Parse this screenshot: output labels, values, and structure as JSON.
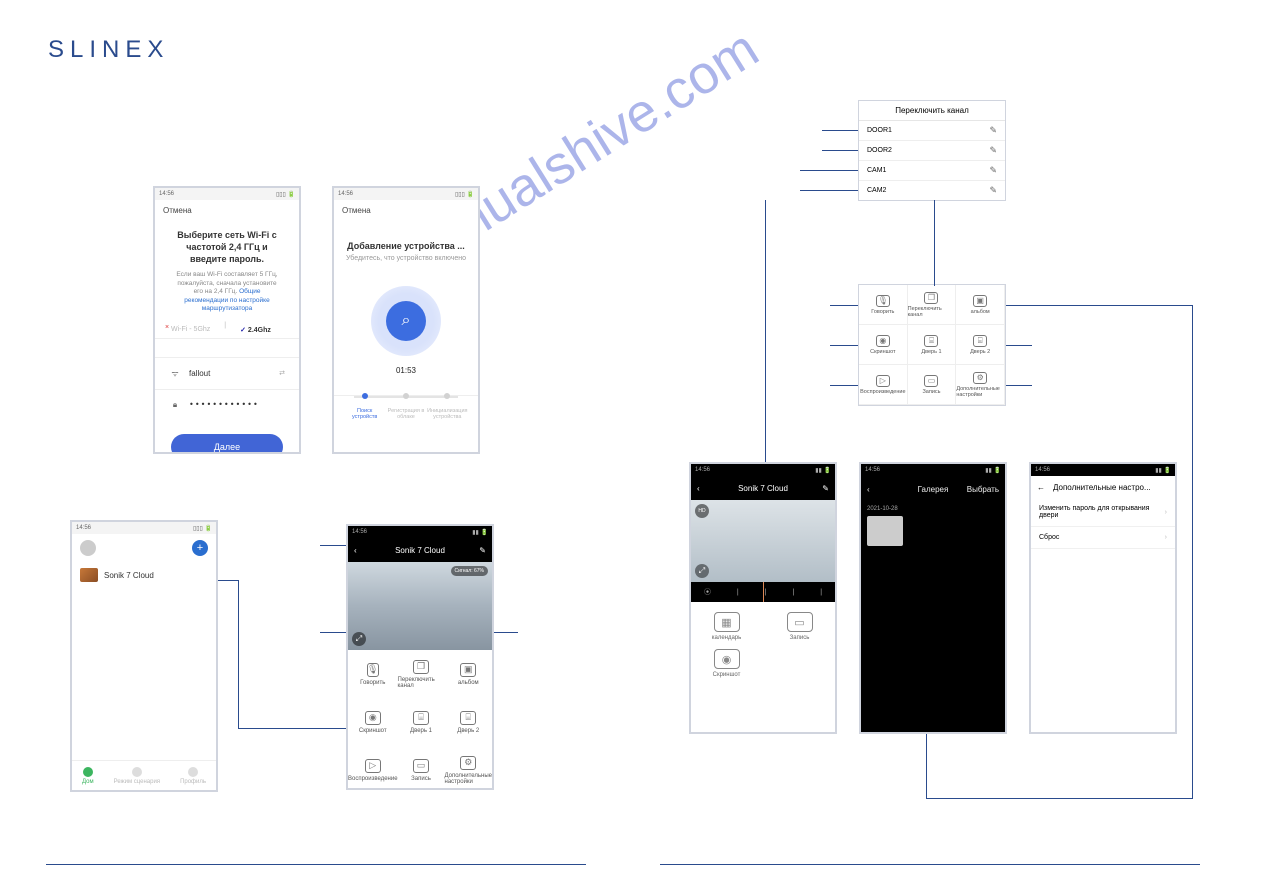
{
  "brand": "SLINEX",
  "watermark": "manualshive.com",
  "screenA": {
    "statusbar_time": "14:56",
    "cancel": "Отмена",
    "title": "Выберите сеть Wi-Fi с частотой 2,4 ГГц и введите пароль.",
    "hint_pre": "Если ваш Wi-Fi составляет 5 ГГц, пожалуйста, сначала установите его на 2,4 ГГц. ",
    "hint_link": "Общие рекомендации по настройке маршрутизатора",
    "tab_5ghz": "Wi-Fi - 5Ghz",
    "tab_24ghz": "Wi-Fi - 2.4Ghz",
    "tab_24short": "2.4Ghz",
    "wifi_name": "fallout",
    "wifi_pwd": "••••••••••••",
    "btn_next": "Далее"
  },
  "screenB": {
    "statusbar_time": "14:56",
    "cancel": "Отмена",
    "title": "Добавление устройства ...",
    "sub": "Убедитесь, что устройство включено",
    "timer": "01:53",
    "step1": "Поиск устройств",
    "step2": "Регистрация в облаке",
    "step3": "Инициализация устройства"
  },
  "screenC": {
    "statusbar_time": "14:56",
    "device_name": "Sonik 7 Cloud",
    "nav_home": "Дом",
    "nav_scene": "Режим сценария",
    "nav_profile": "Профиль"
  },
  "screenD": {
    "title": "Sonik 7 Cloud",
    "signal": "Сигнал: 67%",
    "btn_talk": "Говорить",
    "btn_switch": "Переключить канал",
    "btn_album": "альбом",
    "btn_shot": "Скриншот",
    "btn_door1": "Дверь 1",
    "btn_door2": "Дверь 2",
    "btn_play": "Воспроизведение",
    "btn_rec": "Запись",
    "btn_more": "Дополнительные настройки"
  },
  "panelA": {
    "title": "Переключить канал",
    "rows": [
      "DOOR1",
      "DOOR2",
      "CAM1",
      "CAM2"
    ]
  },
  "panelB": {
    "btn_talk": "Говорить",
    "btn_switch": "Переключить канал",
    "btn_album": "альбом",
    "btn_shot": "Скриншот",
    "btn_door1": "Дверь 1",
    "btn_door2": "Дверь 2",
    "btn_play": "Воспроизведение",
    "btn_rec": "Запись",
    "btn_more": "Дополнительные настройки"
  },
  "screenE": {
    "title": "Sonik 7 Cloud",
    "hd": "HD",
    "play_icon": "⦿",
    "btn_cal": "календарь",
    "btn_rec": "Запись",
    "btn_shot": "Скриншот"
  },
  "screenF": {
    "title": "Галерея",
    "select": "Выбрать",
    "date": "2021-10-28"
  },
  "screenG": {
    "title": "Дополнительные настро...",
    "opt1": "Изменить пароль для открывания двери",
    "opt2": "Сброс"
  }
}
